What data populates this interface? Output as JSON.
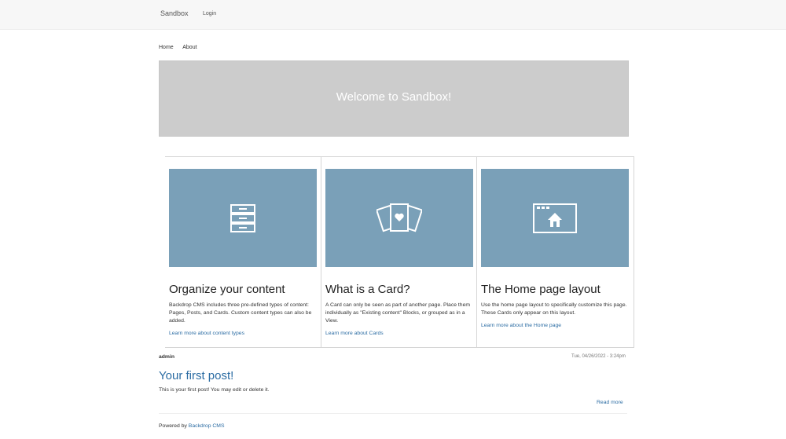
{
  "header": {
    "brand": "Sandbox",
    "login": "Login"
  },
  "nav": {
    "items": [
      "Home",
      "About"
    ]
  },
  "hero": {
    "title": "Welcome to Sandbox!"
  },
  "cards": [
    {
      "icon": "filing-cabinet-icon",
      "title": "Organize your content",
      "text": "Backdrop CMS includes three pre-defined types of content: Pages, Posts, and Cards. Custom content types can also be added.",
      "link": "Learn more about content types"
    },
    {
      "icon": "cards-heart-icon",
      "title": "What is a Card?",
      "text": "A Card can only be seen as part of another page. Place them individually as \"Existing content\" Blocks, or grouped as in a View.",
      "link": "Learn more about Cards"
    },
    {
      "icon": "home-window-icon",
      "title": "The Home page layout",
      "text": "Use the home page layout to specifically customize this page. These Cards only appear on this layout.",
      "link": "Learn more about the Home page"
    }
  ],
  "post": {
    "author": "admin",
    "date": "Tue, 04/26/2022 - 3:24pm",
    "title": "Your first post!",
    "body": "This is your first post! You may edit or delete it.",
    "read_more": "Read more"
  },
  "footer": {
    "prefix": "Powered by ",
    "link": "Backdrop CMS"
  },
  "colors": {
    "card_image_bg": "#7aa0b8",
    "hero_bg": "#cccccc",
    "link": "#2b6ca3"
  }
}
